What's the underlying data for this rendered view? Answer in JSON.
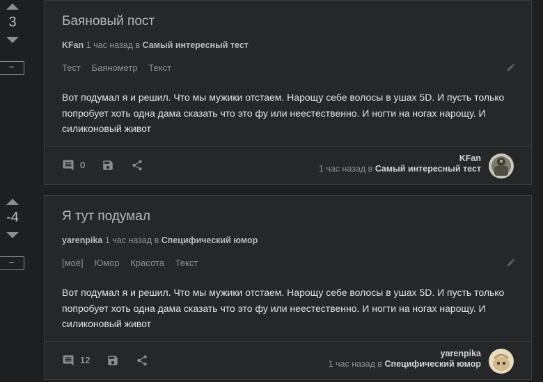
{
  "posts": [
    {
      "votes": "3",
      "collapse_label": "−",
      "title": "Баяновый пост",
      "author": "KFan",
      "time": "1 час назад",
      "in_word": "в",
      "community": "Самый интересный тест",
      "tags": [
        "Тест",
        "Баянометр",
        "Текст"
      ],
      "body": "Вот подумал я и решил. Что мы мужики отстаем. Нарощу себе волосы в ушах 5D. И пусть только попробует хоть одна дама сказать что это фу или неестественно. И ногти на ногах нарощу. И силиконовый живот",
      "comments": "0",
      "avatar_icon": "avatar-knight"
    },
    {
      "votes": "-4",
      "collapse_label": "−",
      "title": "Я тут подумал",
      "author": "yarenpika",
      "time": "1 час назад",
      "in_word": "в",
      "community": "Специфический юмор",
      "tags": [
        "[моё]",
        "Юмор",
        "Красота",
        "Текст"
      ],
      "body": "Вот подумал я и решил. Что мы мужики отстаем. Нарощу себе волосы в ушах 5D. И пусть только попробует хоть одна дама сказать что это фу или неестественно. И ногти на ногах нарощу. И силиконовый живот",
      "comments": "12",
      "avatar_icon": "avatar-cartoon"
    }
  ],
  "icons": {
    "comment": "comment-icon",
    "save": "save-icon",
    "share": "share-icon",
    "edit": "edit-icon",
    "vote_up": "arrow-up-icon",
    "vote_down": "arrow-down-icon"
  },
  "colors": {
    "background": "#1e1f21",
    "card": "#262729",
    "border": "#3b3c3f",
    "text": "#e3e4e6",
    "muted": "#8d9094"
  }
}
